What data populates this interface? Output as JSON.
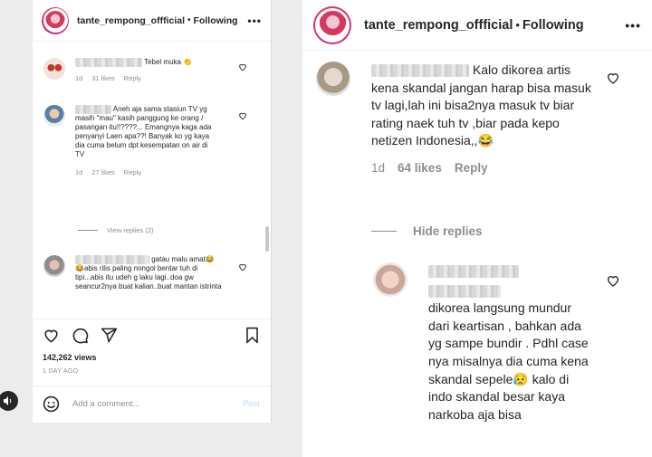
{
  "left": {
    "header": {
      "username": "tante_rempong_offficial",
      "separator": "•",
      "following": "Following"
    },
    "comments": [
      {
        "text": "Tebel muka 👏",
        "time": "1d",
        "likes": "31 likes",
        "reply": "Reply"
      },
      {
        "text": "Aneh aja sama stasiun TV yg masih \"mau\" kasih panggung ke orang / pasangan itu!!????... Emangnya kaga ada penyanyi Laen apa??! Banyak ko yg kaya dia cuma belum dpt kesempatan on air di TV",
        "time": "1d",
        "likes": "27 likes",
        "reply": "Reply",
        "view_replies": "View replies (2)"
      },
      {
        "text": "gatau malu amat😂 😂abis rilis paling nongol bentar tuh di tipi...abis itu udeh g laku lagi..doa gw seancur2nya buat kalian..buat mantan istrinta"
      }
    ],
    "views": "142,262 views",
    "date": "1 DAY AGO",
    "add_comment_placeholder": "Add a comment...",
    "post_label": "Post"
  },
  "right": {
    "header": {
      "username": "tante_rempong_offficial",
      "separator": "•",
      "following": "Following"
    },
    "comment": {
      "text": "Kalo dikorea artis kena skandal jangan harap bisa masuk tv lagi,lah ini bisa2nya masuk tv biar rating naek tuh tv ,biar pada kepo netizen Indonesia,,😂",
      "time": "1d",
      "likes": "64 likes",
      "reply": "Reply"
    },
    "hide_replies": "Hide replies",
    "reply_comment": {
      "text": "dikorea langsung mundur dari keartisan , bahkan ada yg sampe bundir . Pdhl case nya misalnya dia cuma kena skandal sepele😥 kalo di indo skandal besar kaya narkoba aja bisa"
    }
  },
  "colors": {
    "muted": "#8e8e8e",
    "link": "#b2dffc",
    "text": "#262626"
  },
  "icons": [
    "heart-icon",
    "comment-icon",
    "share-icon",
    "bookmark-icon",
    "emoji-icon",
    "more-icon",
    "sound-icon"
  ]
}
